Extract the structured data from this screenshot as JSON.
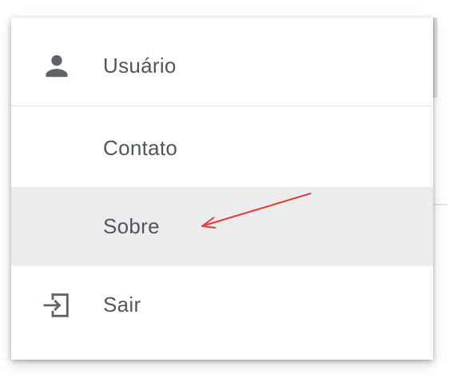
{
  "menu": {
    "items": [
      {
        "label": "Usuário",
        "icon": "person-icon",
        "highlighted": false
      },
      {
        "label": "Contato",
        "icon": "",
        "highlighted": false
      },
      {
        "label": "Sobre",
        "icon": "",
        "highlighted": true
      },
      {
        "label": "Sair",
        "icon": "logout-icon",
        "highlighted": false
      }
    ]
  },
  "colors": {
    "text": "#505660",
    "icon": "#5f6368",
    "highlight": "#ececec",
    "annotation_arrow": "#e53935"
  }
}
